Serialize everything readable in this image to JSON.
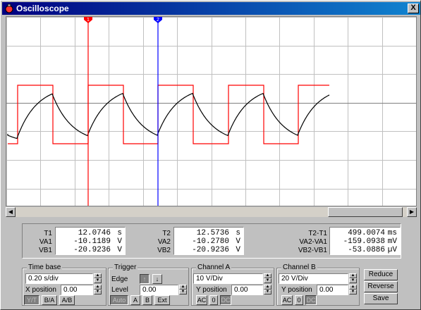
{
  "window": {
    "title": "Oscilloscope",
    "close_label": "X"
  },
  "colors": {
    "channel_a": "#ff0000",
    "channel_b": "#000000",
    "cursor1": "#ff0000",
    "cursor2": "#0000ff",
    "grid": "#c0c0c0"
  },
  "cursors": {
    "t1_label": "1",
    "t2_label": "2"
  },
  "readout": {
    "t1": {
      "label": "T1",
      "value": "12.0746",
      "unit": "s"
    },
    "va1": {
      "label": "VA1",
      "value": "-10.1189",
      "unit": "V"
    },
    "vb1": {
      "label": "VB1",
      "value": "-20.9236",
      "unit": "V"
    },
    "t2": {
      "label": "T2",
      "value": "12.5736",
      "unit": "s"
    },
    "va2": {
      "label": "VA2",
      "value": "-10.2780",
      "unit": "V"
    },
    "vb2": {
      "label": "VB2",
      "value": "-20.9236",
      "unit": "V"
    },
    "dt": {
      "label": "T2-T1",
      "value": "499.0074",
      "unit": "ms"
    },
    "dva": {
      "label": "VA2-VA1",
      "value": "-159.0938",
      "unit": "mV"
    },
    "dvb": {
      "label": "VB2-VB1",
      "value": "-53.0886",
      "unit": "µV"
    }
  },
  "timebase": {
    "title": "Time base",
    "scale": "0.20 s/div",
    "xpos_label": "X position",
    "xpos": "0.00",
    "modes": [
      "Y/T",
      "B/A",
      "A/B"
    ]
  },
  "trigger": {
    "title": "Trigger",
    "edge_label": "Edge",
    "level_label": "Level",
    "level": "0.00",
    "sources": [
      "Auto",
      "A",
      "B",
      "Ext"
    ]
  },
  "channel_a": {
    "title": "Channel A",
    "scale": "10 V/Div",
    "ypos_label": "Y position",
    "ypos": "0.00",
    "coupling": [
      "AC",
      "0",
      "DC"
    ]
  },
  "channel_b": {
    "title": "Channel B",
    "scale": "20 V/Div",
    "ypos_label": "Y position",
    "ypos": "0.00",
    "coupling": [
      "AC",
      "0",
      "DC"
    ]
  },
  "buttons": {
    "reduce": "Reduce",
    "reverse": "Reverse",
    "save": "Save"
  }
}
